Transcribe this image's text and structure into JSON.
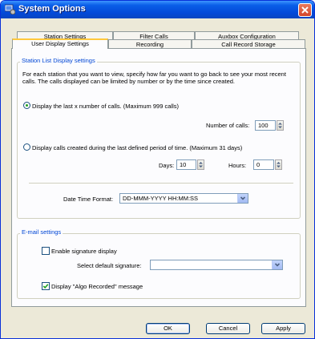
{
  "window": {
    "title": "System Options"
  },
  "tabs": {
    "row_back": [
      "Station Settings",
      "Filter Calls",
      "Auxbox Configuration"
    ],
    "row_front": [
      "User Display Settings",
      "Recording",
      "Call Record Storage"
    ],
    "active": "User Display Settings"
  },
  "station_group": {
    "title": "Station List Display settings",
    "description": "For each station that you want to view, specify how far you want to go back to see your most recent calls. The calls displayed can be limited by number or by the time since created.",
    "radio_last_calls_label": "Display the last x number of calls. (Maximum 999 calls)",
    "radio_last_calls_selected": true,
    "number_of_calls_label": "Number of calls:",
    "number_of_calls_value": "100",
    "radio_period_label": "Display calls created during the last defined period of time. (Maximum 31 days)",
    "radio_period_selected": false,
    "days_label": "Days:",
    "days_value": "10",
    "hours_label": "Hours:",
    "hours_value": "0",
    "date_time_format_label": "Date Time Format:",
    "date_time_format_value": "DD-MMM-YYYY HH:MM:SS"
  },
  "email_group": {
    "title": "E-mail settings",
    "enable_signature_label": "Enable signature display",
    "enable_signature_checked": false,
    "select_signature_label": "Select default signature:",
    "select_signature_value": "",
    "algo_recorded_label": "Display \"Algo Recorded\" message",
    "algo_recorded_checked": true
  },
  "buttons": {
    "ok": "OK",
    "cancel": "Cancel",
    "apply": "Apply"
  },
  "colors": {
    "title_bar": "#0a5ee8",
    "group_title": "#0046d5",
    "dialog_bg": "#ece9d8",
    "check_green": "#21a121"
  }
}
